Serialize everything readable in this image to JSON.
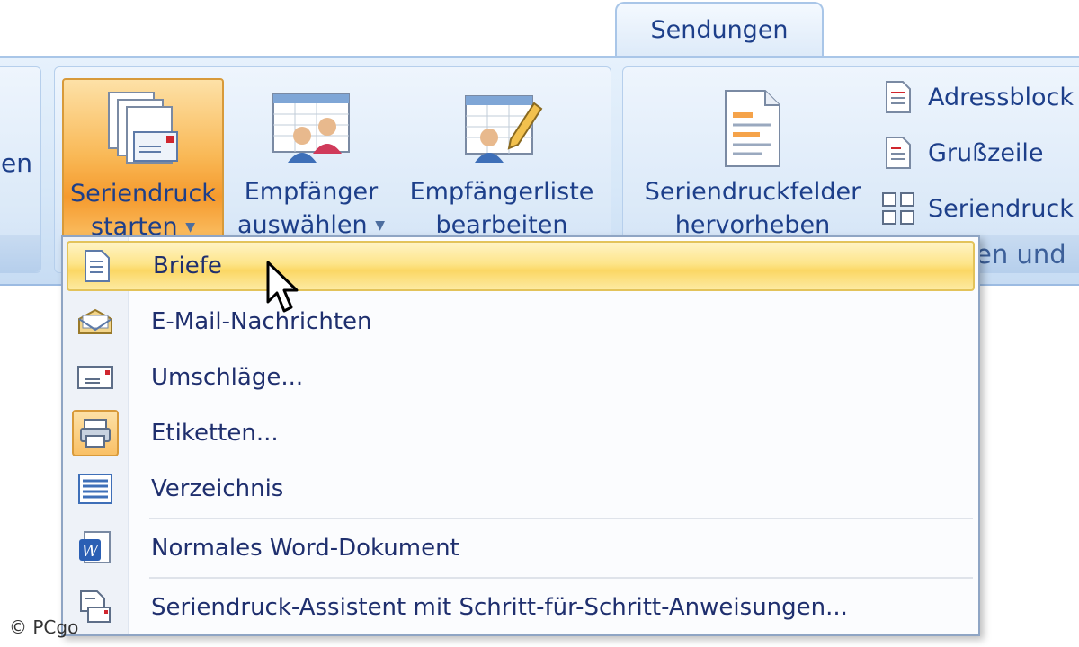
{
  "tab": {
    "label": "Sendungen"
  },
  "ribbon": {
    "left_fragment": "en",
    "start_group": {
      "seriendruck_starten": {
        "line1": "Seriendruck",
        "line2": "starten"
      },
      "empfaenger_auswaehlen": {
        "line1": "Empfänger",
        "line2": "auswählen"
      },
      "empfaengerliste_bearbeiten": {
        "line1": "Empfängerliste",
        "line2": "bearbeiten"
      }
    },
    "write_group": {
      "hervorheben": {
        "line1": "Seriendruckfelder",
        "line2": "hervorheben"
      },
      "adressblock": "Adressblock",
      "grusszeile": "Grußzeile",
      "seriendruckfeld": "Seriendruck",
      "label": "en und"
    }
  },
  "menu": {
    "items": [
      {
        "label": "Briefe",
        "icon": "letter-icon"
      },
      {
        "label": "E-Mail-Nachrichten",
        "icon": "email-icon"
      },
      {
        "label": "Umschläge...",
        "icon": "envelope-icon"
      },
      {
        "label": "Etiketten...",
        "icon": "labels-icon"
      },
      {
        "label": "Verzeichnis",
        "icon": "directory-icon"
      },
      {
        "label": "Normales Word-Dokument",
        "icon": "word-document-icon"
      },
      {
        "label": "Seriendruck-Assistent mit Schritt-für-Schritt-Anweisungen...",
        "icon": "wizard-icon"
      }
    ]
  },
  "watermark": "© PCgo"
}
